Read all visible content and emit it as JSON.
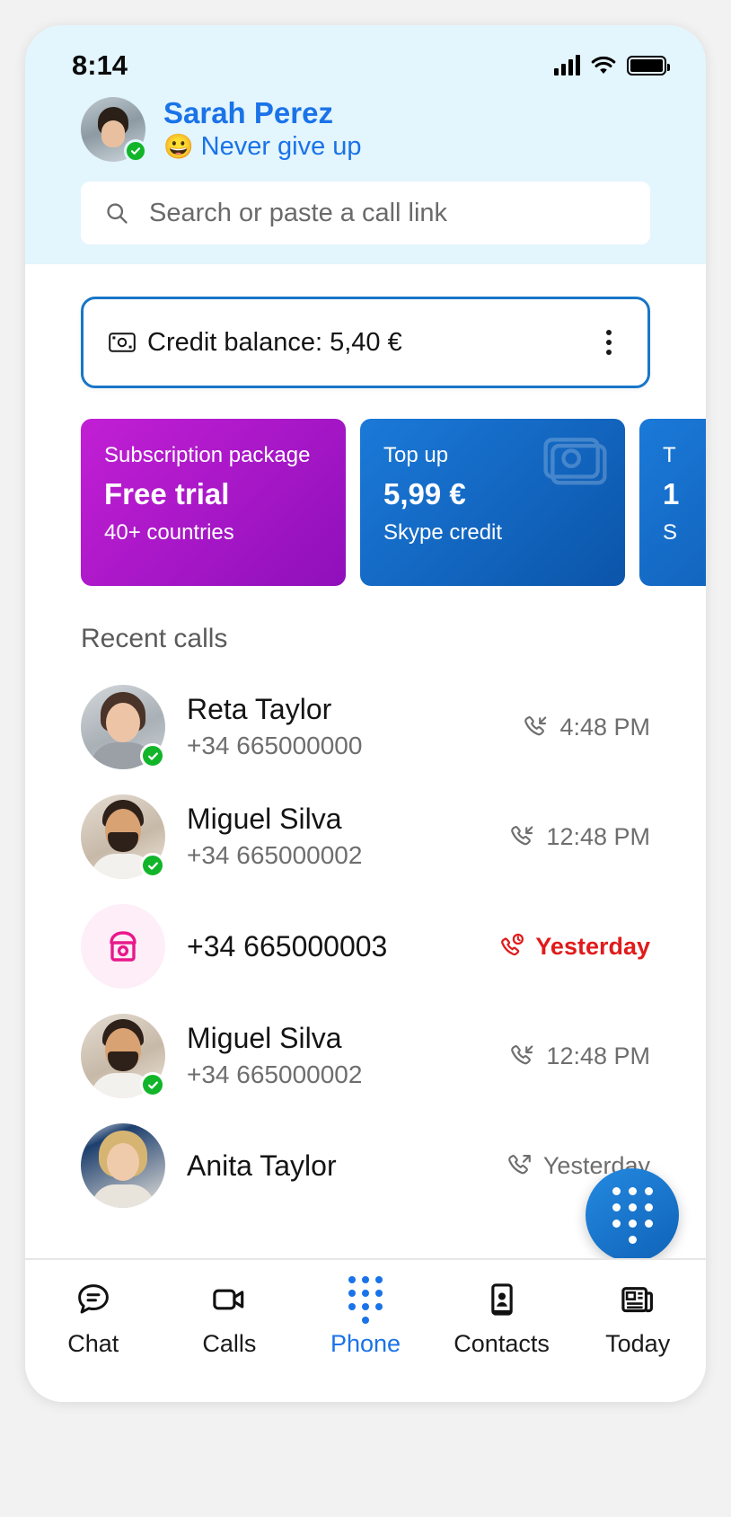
{
  "status_bar": {
    "time": "8:14",
    "icons": [
      "signal-icon",
      "wifi-icon",
      "battery-icon"
    ]
  },
  "profile": {
    "name": "Sarah Perez",
    "mood_emoji": "😀",
    "mood_text": "Never give up",
    "presence": "available"
  },
  "search": {
    "placeholder": "Search or paste a call link",
    "icon": "search-icon"
  },
  "credit": {
    "icon": "money-icon",
    "label": "Credit balance: 5,40 €",
    "menu_icon": "kebab-menu-icon"
  },
  "promos": [
    {
      "kicker": "Subscription package",
      "main": "Free trial",
      "sub": "40+ countries",
      "style": "purple",
      "color": "#b018c8"
    },
    {
      "kicker": "Top up",
      "main": "5,99 €",
      "sub": "Skype credit",
      "style": "blue",
      "color": "#1671cc",
      "icon": "money-icon"
    },
    {
      "kicker": "T",
      "main": "1",
      "sub": "S",
      "style": "blue",
      "color": "#1b79d8"
    }
  ],
  "recent_calls": {
    "title": "Recent calls",
    "items": [
      {
        "name": "Reta Taylor",
        "number": "+34 665000000",
        "time": "4:48 PM",
        "call_type": "incoming",
        "icon": "call-incoming-icon",
        "avatar": "av-reta",
        "presence": "available",
        "missed": false
      },
      {
        "name": "Miguel Silva",
        "number": "+34 665000002",
        "time": "12:48 PM",
        "call_type": "incoming",
        "icon": "call-incoming-icon",
        "avatar": "av-miguel",
        "presence": "available",
        "missed": false
      },
      {
        "name": "",
        "number": "+34 665000003",
        "time": "Yesterday",
        "call_type": "missed",
        "icon": "call-missed-icon",
        "avatar": "unknown-caller-icon",
        "presence": "none",
        "missed": true
      },
      {
        "name": "Miguel Silva",
        "number": "+34 665000002",
        "time": "12:48 PM",
        "call_type": "incoming",
        "icon": "call-incoming-icon",
        "avatar": "av-miguel",
        "presence": "available",
        "missed": false
      },
      {
        "name": "Anita Taylor",
        "number": "",
        "time": "Yesterday",
        "call_type": "outgoing",
        "icon": "call-outgoing-icon",
        "avatar": "av-anita",
        "presence": "none",
        "missed": false
      }
    ]
  },
  "fab": {
    "name": "dialpad-fab",
    "color": "#1671cc"
  },
  "bottom_nav": {
    "active": "Phone",
    "items": [
      {
        "label": "Chat",
        "icon": "chat-bubble-icon"
      },
      {
        "label": "Calls",
        "icon": "video-camera-icon"
      },
      {
        "label": "Phone",
        "icon": "dialpad-icon"
      },
      {
        "label": "Contacts",
        "icon": "contact-card-icon"
      },
      {
        "label": "Today",
        "icon": "news-icon"
      }
    ]
  },
  "colors": {
    "header_bg": "#e3f5fd",
    "accent": "#1a73e8",
    "credit_border": "#1876c8",
    "missed_red": "#e01b1b",
    "presence_green": "#12b52a",
    "pink": "#e8198b"
  }
}
